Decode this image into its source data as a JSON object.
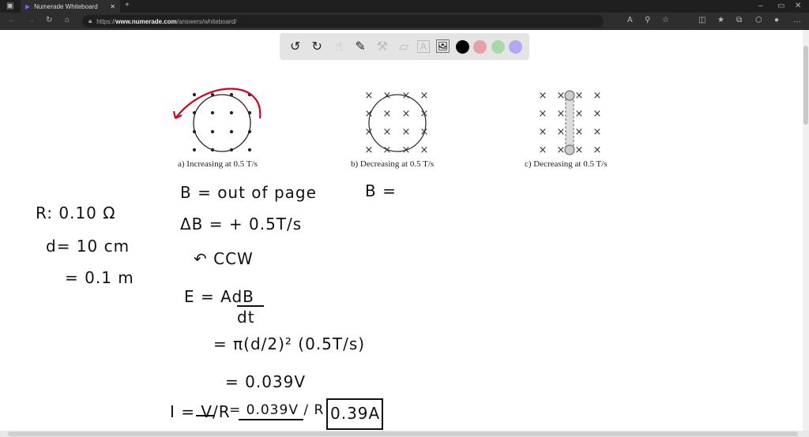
{
  "browser": {
    "tab_title": "Numerade Whiteboard",
    "url_prefix": "https://",
    "url_host": "www.numerade.com",
    "url_path": "/answers/whiteboard/"
  },
  "toolbar": {
    "colors": [
      "#000000",
      "#e8a0a8",
      "#a8d8a8",
      "#b0a8f0"
    ]
  },
  "figure": {
    "caption_a": "a) Increasing at 0.5 T/s",
    "caption_b": "b) Decreasing at 0.5 T/s",
    "caption_c": "c) Decreasing at 0.5 T/s"
  },
  "notes": {
    "r": "R: 0.10 Ω",
    "d": "d= 10 cm",
    "d2": "= 0.1 m",
    "b_a": "B = out of page",
    "b_b": "B =",
    "db": "ΔB = + 0.5T/s",
    "ccw": "↶ CCW",
    "emf1": "E = AdB",
    "emf1b": "dt",
    "emf2": "= π(d/2)² (0.5T/s)",
    "emf3": "= 0.039V",
    "i_lhs": "I = V/R",
    "i_mid": "= 0.039V / R",
    "i_ans": "0.39A"
  }
}
